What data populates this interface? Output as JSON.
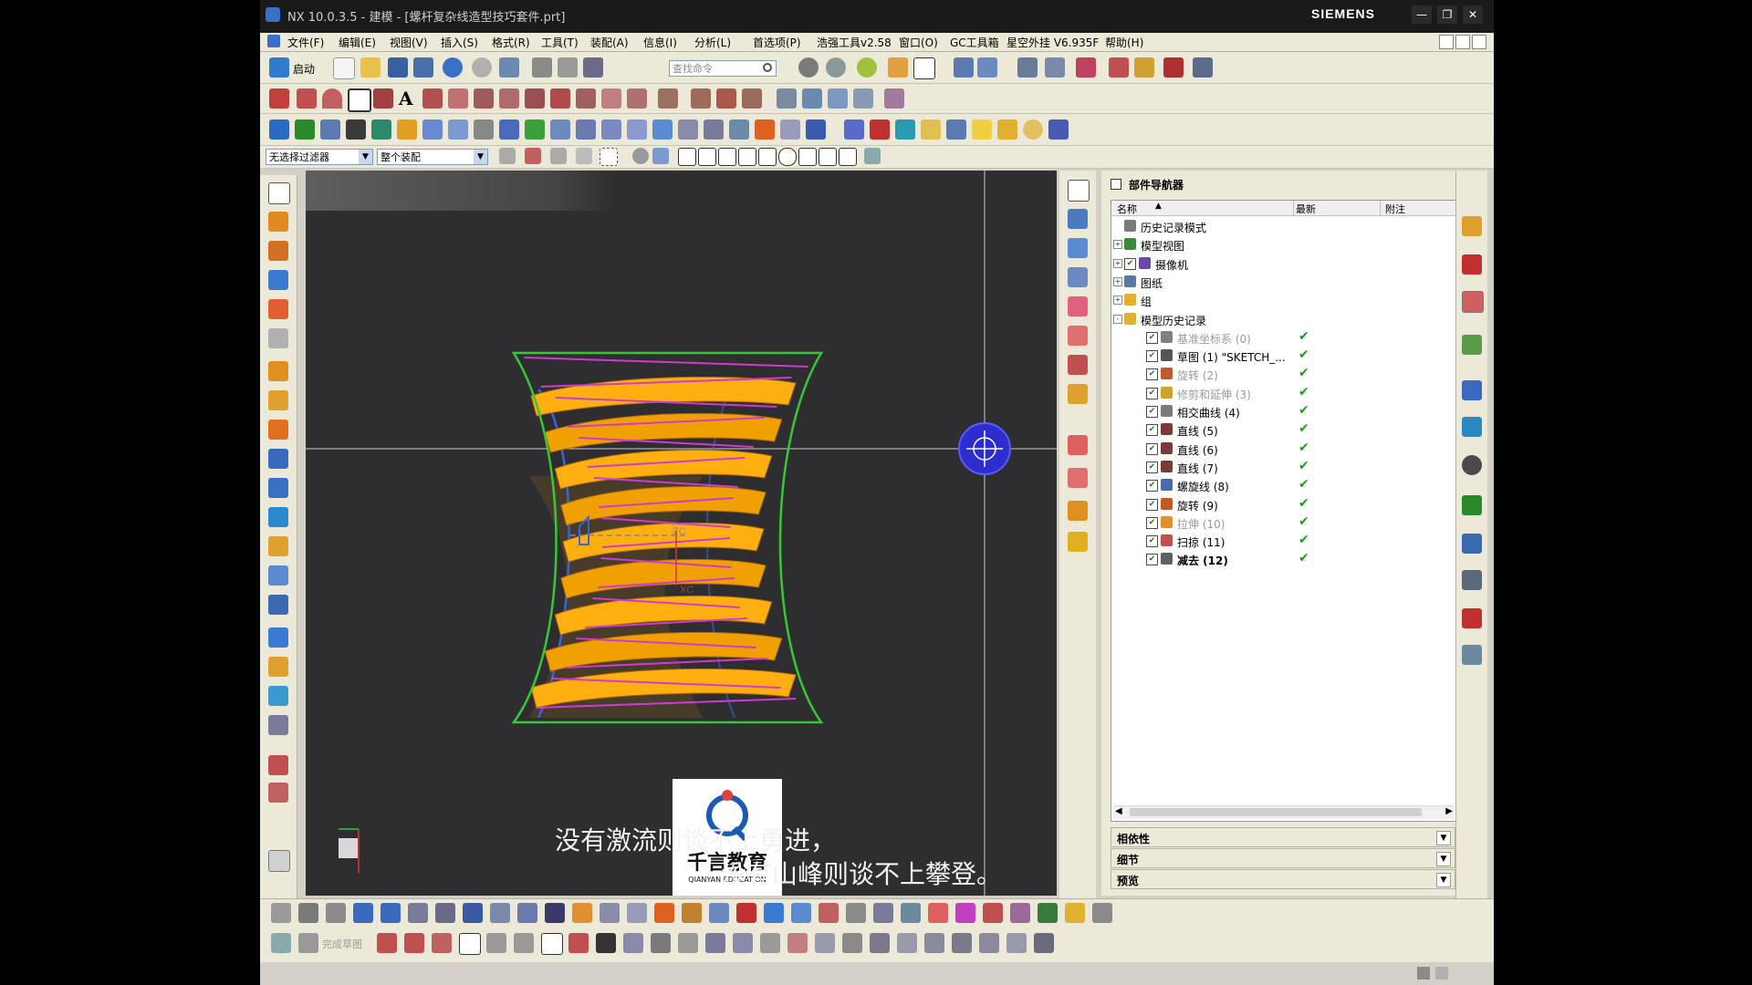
{
  "window": {
    "title": "NX 10.0.3.5 - 建模 - [螺杆复杂线造型技巧套件.prt]",
    "brand": "SIEMENS",
    "buttons": [
      "—",
      "❐",
      "✕"
    ]
  },
  "menu": [
    "文件(F)",
    "编辑(E)",
    "视图(V)",
    "插入(S)",
    "格式(R)",
    "工具(T)",
    "装配(A)",
    "信息(I)",
    "分析(L)",
    "首选项(P)",
    "浩强工具v2.58",
    "窗口(O)",
    "GC工具箱",
    "星空外挂 V6.935F",
    "帮助(H)"
  ],
  "toolbar": {
    "start_label": "启动",
    "search_placeholder": "查找命令"
  },
  "selection": {
    "filter": "无选择过滤器",
    "scope": "整个装配"
  },
  "navigator": {
    "title": "部件导航器",
    "columns": [
      "名称",
      "最新",
      "附注"
    ],
    "rows": [
      {
        "label": "历史记录模式",
        "indent": 0,
        "expander": "",
        "check": false,
        "latest": false,
        "dim": false,
        "icon": "clock-icon",
        "color": "#7a7a7a"
      },
      {
        "label": "模型视图",
        "indent": 0,
        "expander": "+",
        "check": false,
        "latest": false,
        "dim": false,
        "icon": "view-icon",
        "color": "#3a8a3a"
      },
      {
        "label": "摄像机",
        "indent": 0,
        "expander": "+",
        "check": true,
        "latest": false,
        "dim": false,
        "icon": "camera-icon",
        "color": "#6a4aa0"
      },
      {
        "label": "图纸",
        "indent": 0,
        "expander": "+",
        "check": false,
        "latest": false,
        "dim": false,
        "icon": "drawing-icon",
        "color": "#5a7aa0"
      },
      {
        "label": "组",
        "indent": 0,
        "expander": "+",
        "check": false,
        "latest": false,
        "dim": false,
        "icon": "folder-icon",
        "color": "#e0b030"
      },
      {
        "label": "模型历史记录",
        "indent": 0,
        "expander": "-",
        "check": false,
        "latest": false,
        "dim": false,
        "icon": "folder-icon",
        "color": "#e0b030"
      },
      {
        "label": "基准坐标系 (0)",
        "indent": 1,
        "expander": "",
        "check": true,
        "latest": true,
        "dim": true,
        "icon": "datum-csys-icon",
        "color": "#808080"
      },
      {
        "label": "草图 (1) \"SKETCH_...",
        "indent": 1,
        "expander": "",
        "check": true,
        "latest": true,
        "dim": false,
        "icon": "sketch-icon",
        "color": "#555555"
      },
      {
        "label": "旋转 (2)",
        "indent": 1,
        "expander": "",
        "check": true,
        "latest": true,
        "dim": true,
        "icon": "revolve-icon",
        "color": "#c05a2a"
      },
      {
        "label": "修剪和延伸 (3)",
        "indent": 1,
        "expander": "",
        "check": true,
        "latest": true,
        "dim": true,
        "icon": "trim-extend-icon",
        "color": "#d0a030"
      },
      {
        "label": "相交曲线 (4)",
        "indent": 1,
        "expander": "",
        "check": true,
        "latest": true,
        "dim": false,
        "icon": "intersect-curve-icon",
        "color": "#7a7a7a"
      },
      {
        "label": "直线 (5)",
        "indent": 1,
        "expander": "",
        "check": true,
        "latest": true,
        "dim": false,
        "icon": "line-icon",
        "color": "#7a3a3a"
      },
      {
        "label": "直线 (6)",
        "indent": 1,
        "expander": "",
        "check": true,
        "latest": true,
        "dim": false,
        "icon": "line-icon",
        "color": "#7a3a3a"
      },
      {
        "label": "直线 (7)",
        "indent": 1,
        "expander": "",
        "check": true,
        "latest": true,
        "dim": false,
        "icon": "line-icon",
        "color": "#7a3a3a"
      },
      {
        "label": "螺旋线 (8)",
        "indent": 1,
        "expander": "",
        "check": true,
        "latest": true,
        "dim": false,
        "icon": "helix-icon",
        "color": "#4a6ab0"
      },
      {
        "label": "旋转 (9)",
        "indent": 1,
        "expander": "",
        "check": true,
        "latest": true,
        "dim": false,
        "icon": "revolve-icon",
        "color": "#c05a2a"
      },
      {
        "label": "拉伸 (10)",
        "indent": 1,
        "expander": "",
        "check": true,
        "latest": true,
        "dim": true,
        "icon": "extrude-icon",
        "color": "#e09030"
      },
      {
        "label": "扫掠 (11)",
        "indent": 1,
        "expander": "",
        "check": true,
        "latest": true,
        "dim": false,
        "icon": "sweep-icon",
        "color": "#c05050"
      },
      {
        "label": "减去 (12)",
        "indent": 1,
        "expander": "",
        "check": true,
        "latest": true,
        "dim": false,
        "bold": true,
        "icon": "subtract-icon",
        "color": "#606060"
      }
    ],
    "sections": [
      "相依性",
      "细节",
      "预览"
    ]
  },
  "viewport": {
    "bg_color": "#2e2e30",
    "axis_labels": [
      "ZC",
      "XC"
    ]
  },
  "bottom_toolbar": {
    "finish_sketch_label": "完成草图"
  },
  "overlay": {
    "logo_text": "千言教育",
    "logo_sub": "QIANYAN EDUCATION",
    "subtitle_line1": "没有激流则谈不上勇进，",
    "subtitle_line2": "没有山峰则谈不上攀登。"
  }
}
